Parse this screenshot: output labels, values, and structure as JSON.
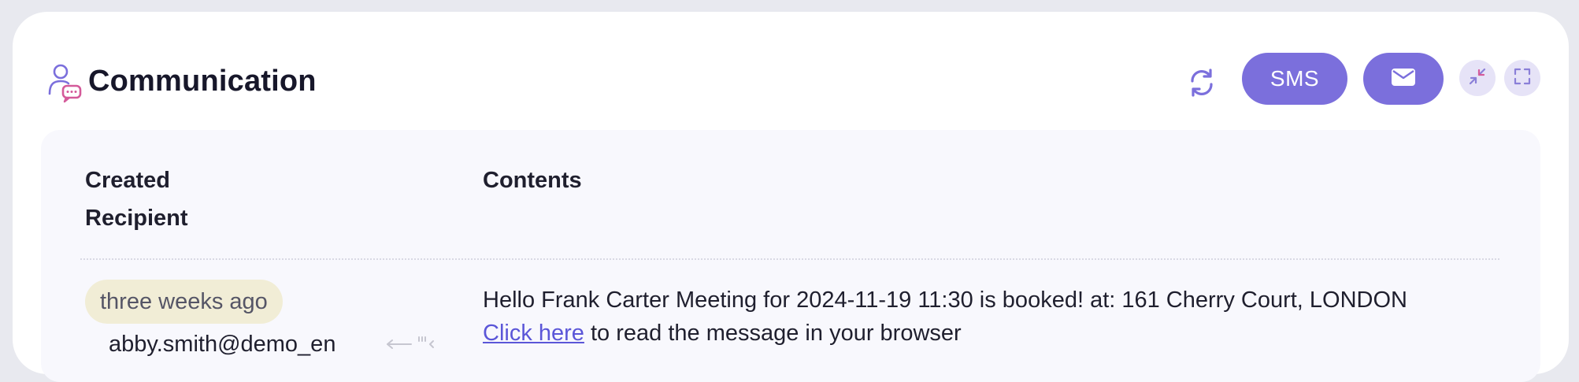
{
  "header": {
    "title": "Communication",
    "sms_label": "SMS",
    "icons": {
      "title": "user-chat-icon",
      "refresh": "refresh-icon",
      "email": "envelope-icon",
      "collapse": "collapse-icon",
      "expand": "expand-icon"
    }
  },
  "table": {
    "columns": {
      "created": "Created",
      "recipient": "Recipient",
      "contents": "Contents"
    },
    "rows": [
      {
        "created": "three weeks ago",
        "recipient": "abby.smith@demo_en",
        "message": "Hello Frank Carter Meeting for 2024-11-19 11:30 is booked! at: 161 Cherry Court, LONDON",
        "link_text": "Click here",
        "link_suffix": " to read the message in your browser"
      }
    ]
  },
  "colors": {
    "accent": "#7b6fdc",
    "badge_bg": "#f1edd6",
    "panel_bg": "#f8f8fd"
  }
}
